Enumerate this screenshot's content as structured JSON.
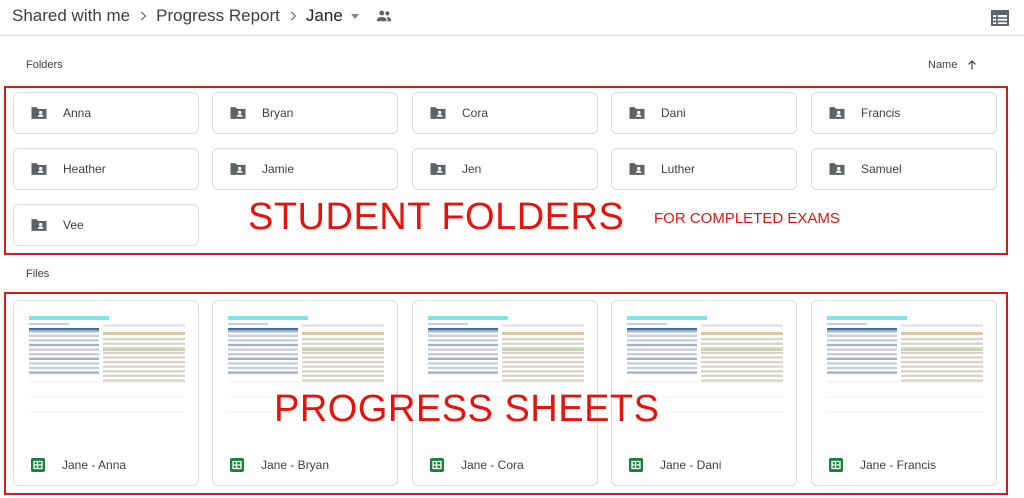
{
  "breadcrumb": {
    "items": [
      "Shared with me",
      "Progress Report",
      "Jane"
    ],
    "icons": {
      "separator": "chevron-right-icon",
      "dropdown": "caret-down-icon",
      "shared": "people-icon",
      "view": "list-view-icon"
    }
  },
  "sections": {
    "folders_label": "Folders",
    "files_label": "Files"
  },
  "sort": {
    "label": "Name",
    "direction_icon": "arrow-up-icon"
  },
  "folders": [
    {
      "name": "Anna"
    },
    {
      "name": "Bryan"
    },
    {
      "name": "Cora"
    },
    {
      "name": "Dani"
    },
    {
      "name": "Francis"
    },
    {
      "name": "Heather"
    },
    {
      "name": "Jamie"
    },
    {
      "name": "Jen"
    },
    {
      "name": "Luther"
    },
    {
      "name": "Samuel"
    },
    {
      "name": "Vee"
    }
  ],
  "files": [
    {
      "name": "Jane - Anna"
    },
    {
      "name": "Jane - Bryan"
    },
    {
      "name": "Jane - Cora"
    },
    {
      "name": "Jane - Dani"
    },
    {
      "name": "Jane - Francis"
    }
  ],
  "annotations": {
    "student_folders": "STUDENT FOLDERS",
    "completed_exams": "FOR COMPLETED EXAMS",
    "progress_sheets": "PROGRESS SHEETS"
  },
  "colors": {
    "annotation_red": "#e8120c",
    "sheets_green": "#188038",
    "border": "#dadce0",
    "icon_gray": "#5f6368"
  }
}
